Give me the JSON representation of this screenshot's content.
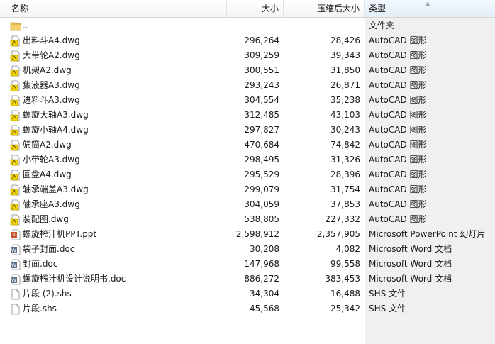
{
  "header": {
    "name": "名称",
    "size": "大小",
    "packed_size": "压缩后大小",
    "type": "类型"
  },
  "colors": {
    "sorted_column_bg": "#f0f0f0",
    "folder": "#e8b94a",
    "dwg_yellow": "#f5d400",
    "ppt": "#c8512b",
    "word": "#2b579a"
  },
  "rows": [
    {
      "name": "..",
      "size": "",
      "packed": "",
      "type": "文件夹",
      "icon": "folder-icon"
    },
    {
      "name": "出料斗A4.dwg",
      "size": "296,264",
      "packed": "28,426",
      "type": "AutoCAD 图形",
      "icon": "dwg-file-icon"
    },
    {
      "name": "大带轮A2.dwg",
      "size": "309,259",
      "packed": "39,343",
      "type": "AutoCAD 图形",
      "icon": "dwg-file-icon"
    },
    {
      "name": "机架A2.dwg",
      "size": "300,551",
      "packed": "31,850",
      "type": "AutoCAD 图形",
      "icon": "dwg-file-icon"
    },
    {
      "name": "集液器A3.dwg",
      "size": "293,243",
      "packed": "26,871",
      "type": "AutoCAD 图形",
      "icon": "dwg-file-icon"
    },
    {
      "name": "进料斗A3.dwg",
      "size": "304,554",
      "packed": "35,238",
      "type": "AutoCAD 图形",
      "icon": "dwg-file-icon"
    },
    {
      "name": "螺旋大轴A3.dwg",
      "size": "312,485",
      "packed": "43,103",
      "type": "AutoCAD 图形",
      "icon": "dwg-file-icon"
    },
    {
      "name": "螺旋小轴A4.dwg",
      "size": "297,827",
      "packed": "30,243",
      "type": "AutoCAD 图形",
      "icon": "dwg-file-icon"
    },
    {
      "name": "筛筒A2.dwg",
      "size": "470,684",
      "packed": "74,842",
      "type": "AutoCAD 图形",
      "icon": "dwg-file-icon"
    },
    {
      "name": "小带轮A3.dwg",
      "size": "298,495",
      "packed": "31,326",
      "type": "AutoCAD 图形",
      "icon": "dwg-file-icon"
    },
    {
      "name": "圆盘A4.dwg",
      "size": "295,529",
      "packed": "28,396",
      "type": "AutoCAD 图形",
      "icon": "dwg-file-icon"
    },
    {
      "name": "轴承端盖A3.dwg",
      "size": "299,079",
      "packed": "31,754",
      "type": "AutoCAD 图形",
      "icon": "dwg-file-icon"
    },
    {
      "name": "轴承座A3.dwg",
      "size": "304,059",
      "packed": "37,853",
      "type": "AutoCAD 图形",
      "icon": "dwg-file-icon"
    },
    {
      "name": "装配图.dwg",
      "size": "538,805",
      "packed": "227,332",
      "type": "AutoCAD 图形",
      "icon": "dwg-file-icon"
    },
    {
      "name": "螺旋榨汁机PPT.ppt",
      "size": "2,598,912",
      "packed": "2,357,905",
      "type": "Microsoft PowerPoint 幻灯片",
      "icon": "ppt-file-icon"
    },
    {
      "name": "袋子封面.doc",
      "size": "30,208",
      "packed": "4,082",
      "type": "Microsoft Word 文档",
      "icon": "word-file-icon"
    },
    {
      "name": "封面.doc",
      "size": "147,968",
      "packed": "99,558",
      "type": "Microsoft Word 文档",
      "icon": "word-file-icon"
    },
    {
      "name": "螺旋榨汁机设计说明书.doc",
      "size": "886,272",
      "packed": "383,453",
      "type": "Microsoft Word 文档",
      "icon": "word-file-icon"
    },
    {
      "name": "片段 (2).shs",
      "size": "34,304",
      "packed": "16,488",
      "type": "SHS 文件",
      "icon": "generic-file-icon"
    },
    {
      "name": "片段.shs",
      "size": "45,568",
      "packed": "25,342",
      "type": "SHS 文件",
      "icon": "generic-file-icon"
    }
  ]
}
